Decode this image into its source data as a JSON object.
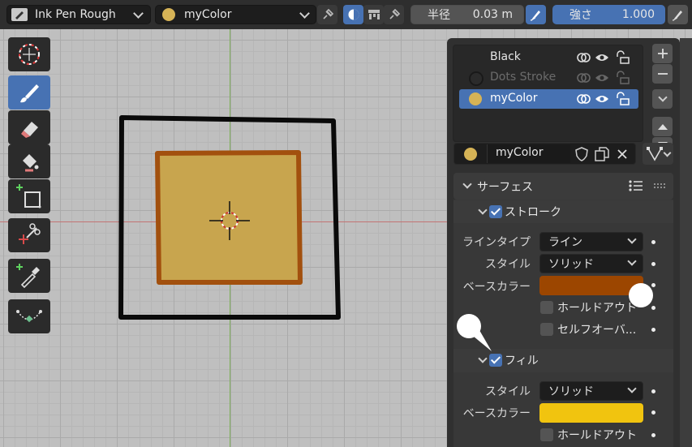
{
  "header": {
    "brush_name": "Ink Pen Rough",
    "material_name": "myColor",
    "radius_label": "半径",
    "radius_value": "0.03 m",
    "strength_label": "強さ",
    "strength_value": "1.000"
  },
  "colors": {
    "accent": "#4772b3",
    "material_gold": "#d6b356",
    "stroke_color": "#9c4600",
    "fill_color": "#f1c40f",
    "inner_fill": "#c8a54e",
    "inner_stroke": "#a2500e"
  },
  "toolbar": {
    "tools": [
      "cursor-icon",
      "draw-brush-icon",
      "erase-icon",
      "fill-bucket-icon",
      "add-box-icon",
      "cutter-icon",
      "eyedropper-icon",
      "curve-icon"
    ]
  },
  "material_slots": [
    {
      "name": "Black",
      "dimmed": false,
      "selected": false
    },
    {
      "name": "Dots Stroke",
      "dimmed": true,
      "selected": false
    },
    {
      "name": "myColor",
      "dimmed": false,
      "selected": true
    }
  ],
  "material_field": {
    "value": "myColor"
  },
  "surface": {
    "title": "サーフェス",
    "stroke_section": "ストローク",
    "line_type_label": "ラインタイプ",
    "line_type_value": "ライン",
    "style_label": "スタイル",
    "style_value": "ソリッド",
    "base_color_label": "ベースカラー",
    "hold_out_label": "ホールドアウト",
    "self_overlap_label": "セルフオーバ...",
    "fill_section": "フィル",
    "fill_style_label": "スタイル",
    "fill_style_value": "ソリッド",
    "fill_base_color_label": "ベースカラー",
    "fill_hold_out_label": "ホールドアウト"
  }
}
